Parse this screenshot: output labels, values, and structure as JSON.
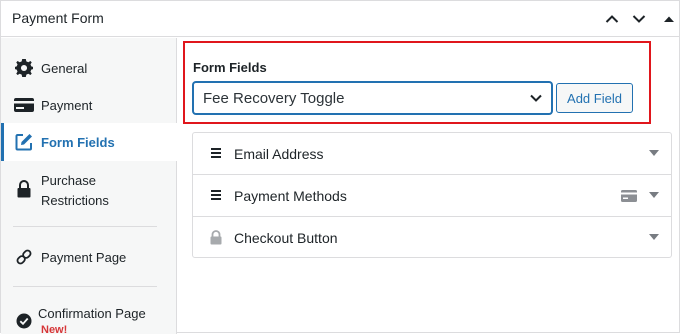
{
  "header": {
    "title": "Payment Form"
  },
  "sidebar": {
    "items": [
      {
        "label": "General",
        "icon": "gear-icon"
      },
      {
        "label": "Payment",
        "icon": "credit-card-icon"
      },
      {
        "label": "Form Fields",
        "icon": "pencil-square-icon",
        "active": true
      },
      {
        "label": "Purchase Restrictions",
        "line1": "Purchase",
        "line2": "Restrictions",
        "icon": "lock-icon"
      },
      {
        "label": "Payment Page",
        "icon": "link-icon"
      },
      {
        "label": "Confirmation Page",
        "icon": "check-circle-icon",
        "badge": "New!"
      }
    ]
  },
  "main": {
    "form_fields_title": "Form Fields",
    "select_value": "Fee Recovery Toggle",
    "add_field_label": "Add Field",
    "fields": [
      {
        "label": "Email Address",
        "icon": "drag-handle-icon"
      },
      {
        "label": "Payment Methods",
        "icon": "drag-handle-icon",
        "extra_icon": "credit-card-icon"
      },
      {
        "label": "Checkout Button",
        "icon": "lock-icon"
      }
    ]
  },
  "colors": {
    "accent": "#2271b1",
    "highlight_border": "#e0161c",
    "new_badge": "#d63638"
  }
}
